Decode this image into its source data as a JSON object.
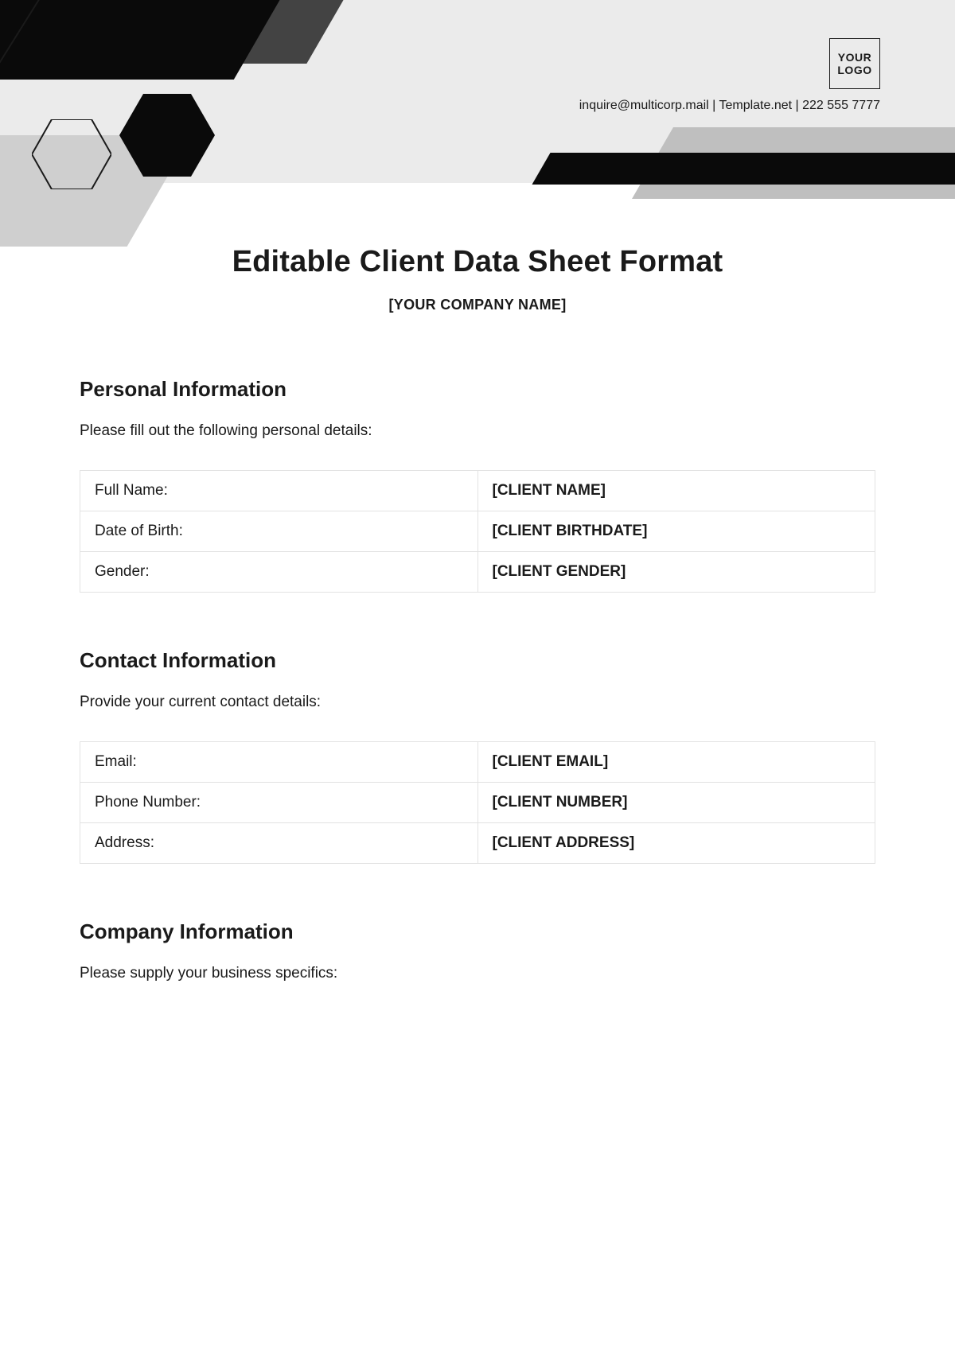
{
  "header": {
    "logo_text": "YOUR LOGO",
    "contact_line": "inquire@multicorp.mail | Template.net | 222 555 7777"
  },
  "title": "Editable Client Data Sheet Format",
  "subtitle": "[YOUR COMPANY NAME]",
  "sections": [
    {
      "heading": "Personal Information",
      "instruction": "Please fill out the following personal details:",
      "rows": [
        {
          "label": "Full Name:",
          "value": "[CLIENT NAME]"
        },
        {
          "label": "Date of Birth:",
          "value": "[CLIENT BIRTHDATE]"
        },
        {
          "label": "Gender:",
          "value": "[CLIENT GENDER]"
        }
      ]
    },
    {
      "heading": "Contact Information",
      "instruction": "Provide your current contact details:",
      "rows": [
        {
          "label": "Email:",
          "value": "[CLIENT EMAIL]"
        },
        {
          "label": "Phone Number:",
          "value": "[CLIENT NUMBER]"
        },
        {
          "label": "Address:",
          "value": "[CLIENT ADDRESS]"
        }
      ]
    },
    {
      "heading": "Company Information",
      "instruction": "Please supply your business specifics:",
      "rows": []
    }
  ]
}
